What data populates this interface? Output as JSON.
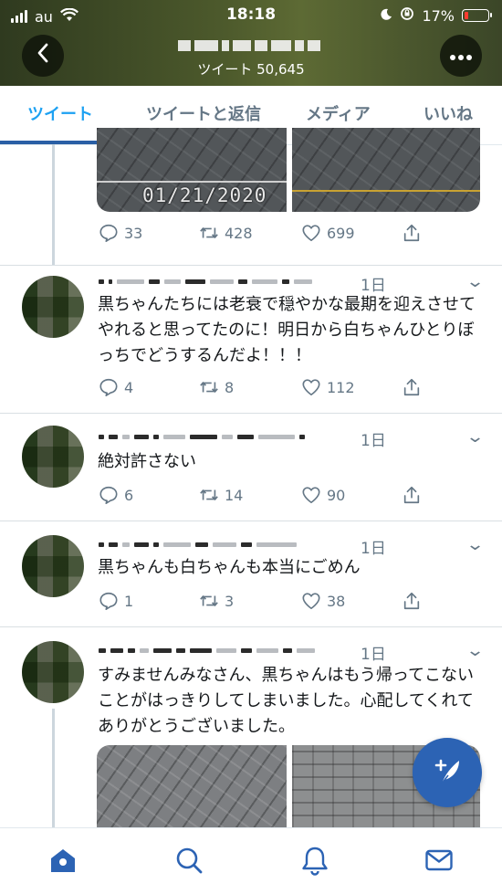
{
  "status_bar": {
    "carrier": "au",
    "time": "18:18",
    "battery": "17%",
    "battery_level": 0.17
  },
  "header": {
    "tweet_count_label": "ツイート 50,645",
    "back_icon": "chevron-left-icon",
    "more_icon": "more-icon"
  },
  "tabs": [
    {
      "label": "ツイート",
      "active": true
    },
    {
      "label": "ツイートと返信",
      "active": false
    },
    {
      "label": "メディア",
      "active": false
    },
    {
      "label": "いいね",
      "active": false
    }
  ],
  "first_tweet": {
    "media_date": "01/21/2020",
    "replies": "33",
    "retweets": "428",
    "likes": "699"
  },
  "tweets": [
    {
      "timeago": "1日",
      "text": "黒ちゃんたちには老衰で穏やかな最期を迎えさせてやれると思ってたのに！明日から白ちゃんひとりぼっちでどうするんだよ！！！",
      "replies": "4",
      "retweets": "8",
      "likes": "112"
    },
    {
      "timeago": "1日",
      "text": "絶対許さない",
      "replies": "6",
      "retweets": "14",
      "likes": "90"
    },
    {
      "timeago": "1日",
      "text": "黒ちゃんも白ちゃんも本当にごめん",
      "replies": "1",
      "retweets": "3",
      "likes": "38"
    },
    {
      "timeago": "1日",
      "text": "すみませんみなさん、黒ちゃんはもう帰ってこないことがはっきりしてしまいました。心配してくれてありがとうございました。"
    }
  ],
  "bottom_nav": [
    "home-icon",
    "search-icon",
    "bell-icon",
    "mail-icon"
  ],
  "colors": {
    "accent": "#1da1f2",
    "tab_underline": "#2a5fa5",
    "fab": "#2c63b4",
    "muted": "#657786"
  }
}
